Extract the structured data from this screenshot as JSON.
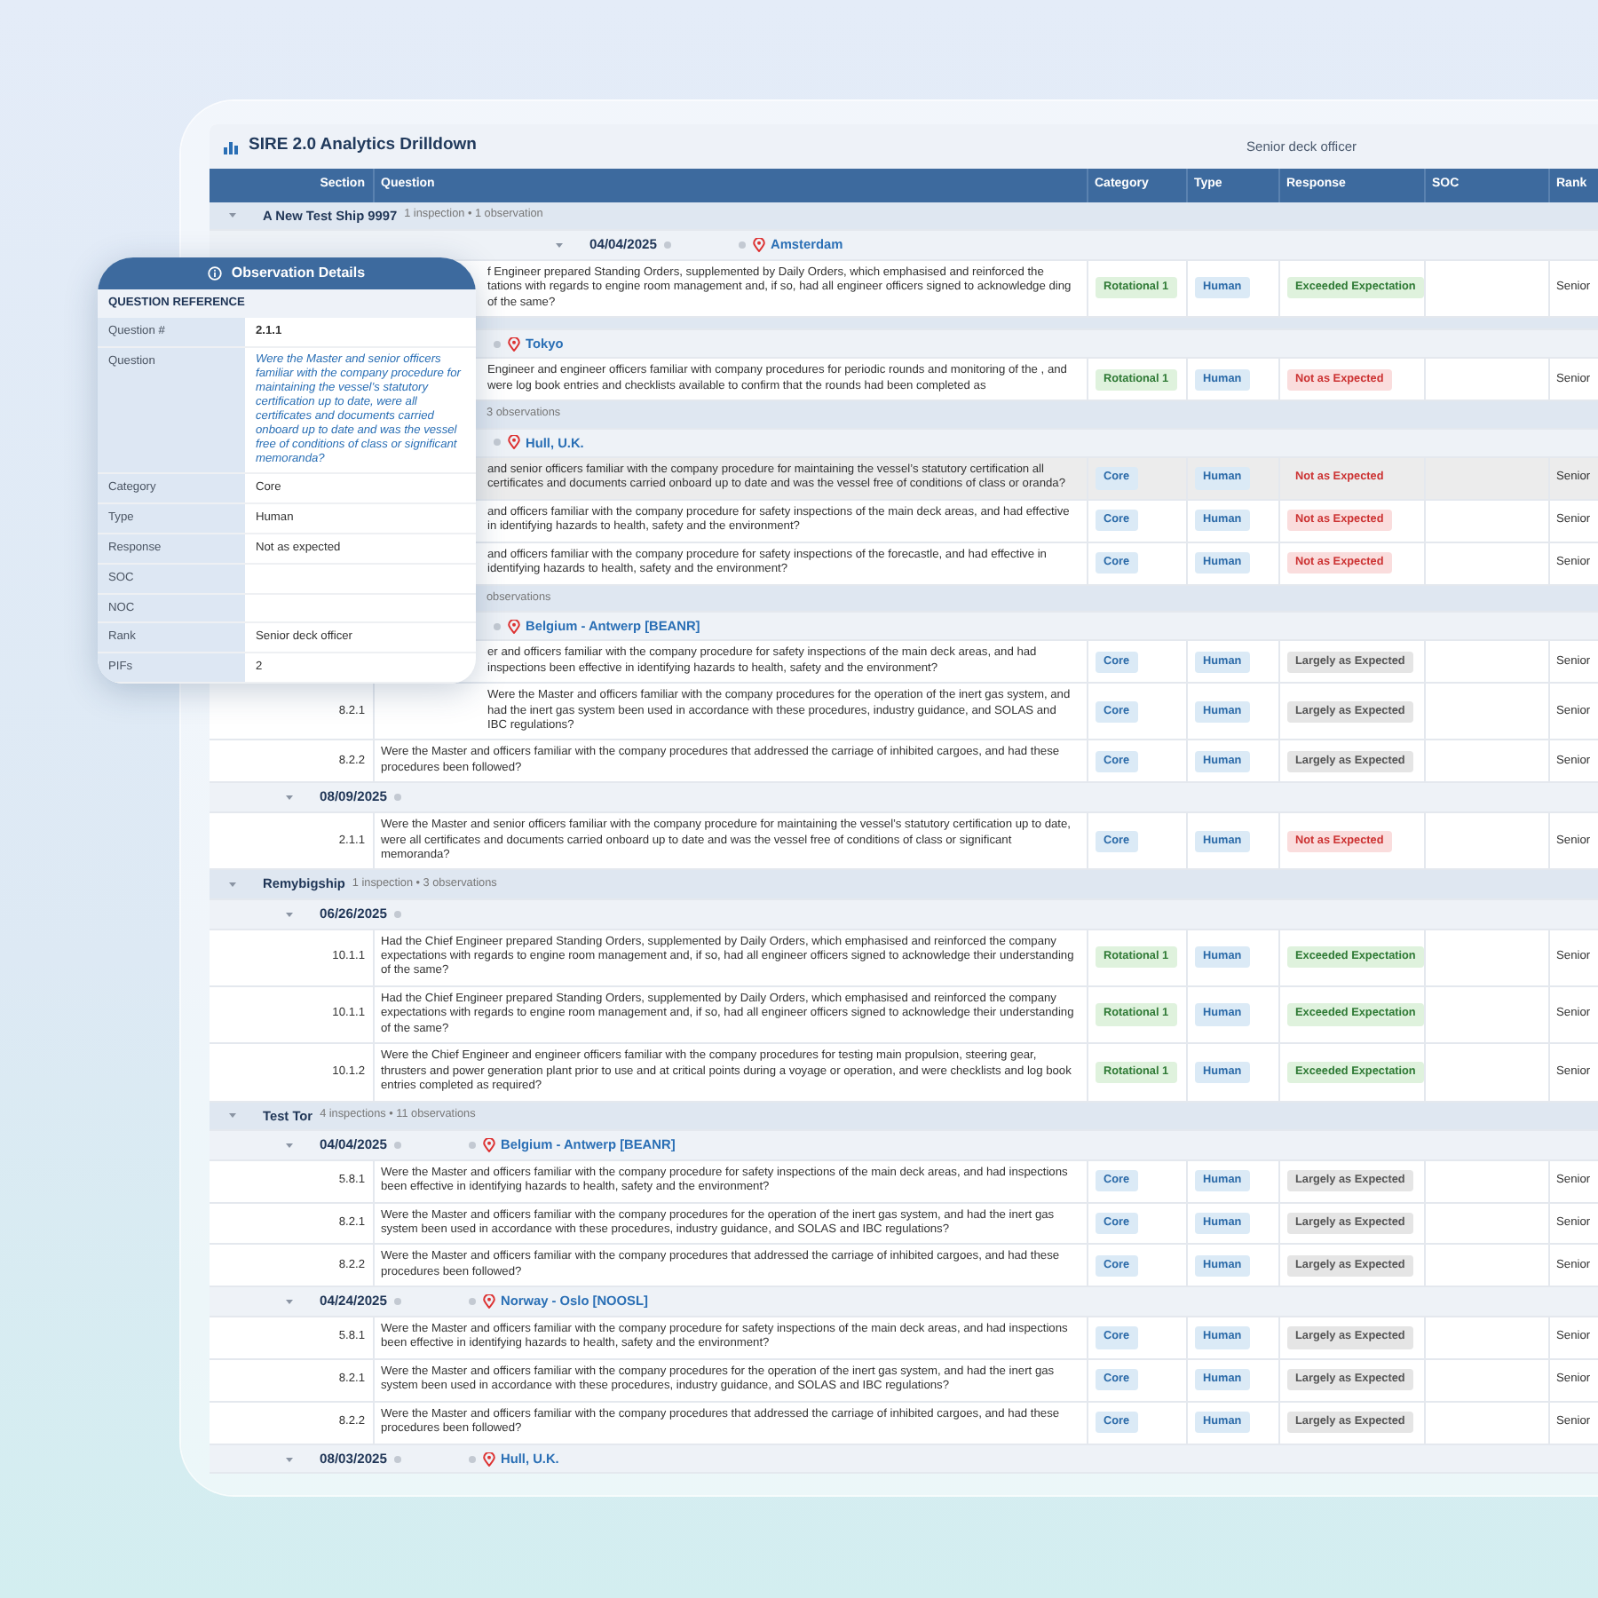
{
  "window": {
    "title": "SIRE 2.0 Analytics Drilldown",
    "filter": "Senior deck officer"
  },
  "table": {
    "columns": [
      "Section",
      "Question",
      "Category",
      "Type",
      "Response",
      "SOC",
      "Rank"
    ],
    "groups": [
      {
        "name": "A New Test Ship 9997",
        "summary": "1 inspection • 1 observation",
        "expanded": true,
        "inspections": [
          {
            "date": "04/04/2025",
            "location": "Amsterdam",
            "expanded": true,
            "rows": [
              {
                "question": "f Engineer prepared Standing Orders, supplemented by Daily Orders, which emphasised and reinforced the tations with regards to engine room management and, if so, had all engineer officers signed to acknowledge ding of the same?",
                "category": {
                  "text": "Rotational 1",
                  "kind": "rotational"
                },
                "type": "Human",
                "response": {
                  "text": "Exceeded Expectation",
                  "kind": "exceeded"
                },
                "rank": "Senior",
                "selected": false
              }
            ]
          }
        ]
      },
      {
        "inspections": [
          {
            "location": "Tokyo",
            "rows": [
              {
                "question": "Engineer and engineer officers familiar with company procedures for periodic rounds and monitoring of the , and were log book entries and checklists available to confirm that the rounds had been completed as",
                "category": {
                  "text": "Rotational 1",
                  "kind": "rotational"
                },
                "type": "Human",
                "response": {
                  "text": "Not as Expected",
                  "kind": "not"
                },
                "rank": "Senior",
                "selected": false
              }
            ]
          }
        ]
      },
      {
        "summary": "3 observations",
        "inspections": [
          {
            "location": "Hull, U.K.",
            "rows": [
              {
                "question": "and senior officers familiar with the company procedure for maintaining the vessel’s statutory certification all certificates and documents carried onboard up to date and was the vessel free of conditions of class or oranda?",
                "category": {
                  "text": "Core",
                  "kind": "core"
                },
                "type": "Human",
                "response": {
                  "text": "Not as Expected",
                  "kind": "not"
                },
                "rank": "Senior",
                "selected": true
              },
              {
                "question": "and officers familiar with the company procedure for safety inspections of the main deck areas, and had effective in identifying hazards to health, safety and the environment?",
                "category": {
                  "text": "Core",
                  "kind": "core"
                },
                "type": "Human",
                "response": {
                  "text": "Not as Expected",
                  "kind": "not"
                },
                "rank": "Senior",
                "selected": false
              },
              {
                "question": "and officers familiar with the company procedure for safety inspections of the forecastle, and had effective in identifying hazards to health, safety and the environment?",
                "category": {
                  "text": "Core",
                  "kind": "core"
                },
                "type": "Human",
                "response": {
                  "text": "Not as Expected",
                  "kind": "not"
                },
                "rank": "Senior",
                "selected": false
              }
            ]
          }
        ]
      },
      {
        "summary": "observations",
        "inspections": [
          {
            "location": "Belgium - Antwerp [BEANR]",
            "rows": [
              {
                "question": "er and officers familiar with the company procedure for safety inspections of the main deck areas, and had inspections been effective in identifying hazards to health, safety and the environment?",
                "category": {
                  "text": "Core",
                  "kind": "core"
                },
                "type": "Human",
                "response": {
                  "text": "Largely as Expected",
                  "kind": "largely"
                },
                "rank": "Senior",
                "selected": false
              },
              {
                "section": "8.2.1",
                "question": "Were the Master and officers familiar with the company procedures for the operation of the inert gas system, and had the inert gas system been used in accordance with these procedures, industry guidance, and SOLAS and IBC regulations?",
                "category": {
                  "text": "Core",
                  "kind": "core"
                },
                "type": "Human",
                "response": {
                  "text": "Largely as Expected",
                  "kind": "largely"
                },
                "rank": "Senior",
                "selected": false
              },
              {
                "section": "8.2.2",
                "question": "Were the Master and officers familiar with the company procedures that addressed the carriage of inhibited cargoes, and had these procedures been followed?",
                "category": {
                  "text": "Core",
                  "kind": "core"
                },
                "type": "Human",
                "response": {
                  "text": "Largely as Expected",
                  "kind": "largely"
                },
                "rank": "Senior",
                "selected": false
              }
            ]
          },
          {
            "date": "08/09/2025",
            "expanded": true,
            "rows": [
              {
                "section": "2.1.1",
                "question": "Were the Master and senior officers familiar with the company procedure for maintaining the vessel’s statutory certification up to date, were all certificates and documents carried onboard up to date and was the vessel free of conditions of class or significant memoranda?",
                "category": {
                  "text": "Core",
                  "kind": "core"
                },
                "type": "Human",
                "response": {
                  "text": "Not as Expected",
                  "kind": "not"
                },
                "rank": "Senior",
                "selected": false
              }
            ]
          }
        ]
      },
      {
        "name": "Remybigship",
        "summary": "1 inspection • 3 observations",
        "expanded": true,
        "inspections": [
          {
            "date": "06/26/2025",
            "expanded": true,
            "rows": [
              {
                "section": "10.1.1",
                "question": "Had the Chief Engineer prepared Standing Orders, supplemented by Daily Orders, which emphasised and reinforced the company expectations with regards to engine room management and, if so, had all engineer officers signed to acknowledge their understanding of the same?",
                "category": {
                  "text": "Rotational 1",
                  "kind": "rotational"
                },
                "type": "Human",
                "response": {
                  "text": "Exceeded Expectation",
                  "kind": "exceeded"
                },
                "rank": "Senior",
                "selected": false
              },
              {
                "section": "10.1.1",
                "question": "Had the Chief Engineer prepared Standing Orders, supplemented by Daily Orders, which emphasised and reinforced the company expectations with regards to engine room management and, if so, had all engineer officers signed to acknowledge their understanding of the same?",
                "category": {
                  "text": "Rotational 1",
                  "kind": "rotational"
                },
                "type": "Human",
                "response": {
                  "text": "Exceeded Expectation",
                  "kind": "exceeded"
                },
                "rank": "Senior",
                "selected": false
              },
              {
                "section": "10.1.2",
                "question": "Were the Chief Engineer and engineer officers familiar with the company procedures for testing main propulsion, steering gear, thrusters and power generation plant prior to use and at critical points during a voyage or operation, and were checklists and log book entries completed as required?",
                "category": {
                  "text": "Rotational 1",
                  "kind": "rotational"
                },
                "type": "Human",
                "response": {
                  "text": "Exceeded Expectation",
                  "kind": "exceeded"
                },
                "rank": "Senior",
                "selected": false
              }
            ]
          }
        ]
      },
      {
        "name": "Test Tor",
        "summary": "4 inspections • 11 observations",
        "expanded": true,
        "inspections": [
          {
            "date": "04/04/2025",
            "location": "Belgium - Antwerp [BEANR]",
            "expanded": true,
            "rows": [
              {
                "section": "5.8.1",
                "question": "Were the Master and officers familiar with the company procedure for safety inspections of the main deck areas, and had inspections been effective in identifying hazards to health, safety and the environment?",
                "category": {
                  "text": "Core",
                  "kind": "core"
                },
                "type": "Human",
                "response": {
                  "text": "Largely as Expected",
                  "kind": "largely"
                },
                "rank": "Senior",
                "selected": false
              },
              {
                "section": "8.2.1",
                "question": "Were the Master and officers familiar with the company procedures for the operation of the inert gas system, and had the inert gas system been used in accordance with these procedures, industry guidance, and SOLAS and IBC regulations?",
                "category": {
                  "text": "Core",
                  "kind": "core"
                },
                "type": "Human",
                "response": {
                  "text": "Largely as Expected",
                  "kind": "largely"
                },
                "rank": "Senior",
                "selected": false
              },
              {
                "section": "8.2.2",
                "question": "Were the Master and officers familiar with the company procedures that addressed the carriage of inhibited cargoes, and had these procedures been followed?",
                "category": {
                  "text": "Core",
                  "kind": "core"
                },
                "type": "Human",
                "response": {
                  "text": "Largely as Expected",
                  "kind": "largely"
                },
                "rank": "Senior",
                "selected": false
              }
            ]
          },
          {
            "date": "04/24/2025",
            "location": "Norway - Oslo [NOOSL]",
            "expanded": true,
            "rows": [
              {
                "section": "5.8.1",
                "question": "Were the Master and officers familiar with the company procedure for safety inspections of the main deck areas, and had inspections been effective in identifying hazards to health, safety and the environment?",
                "category": {
                  "text": "Core",
                  "kind": "core"
                },
                "type": "Human",
                "response": {
                  "text": "Largely as Expected",
                  "kind": "largely"
                },
                "rank": "Senior",
                "selected": false
              },
              {
                "section": "8.2.1",
                "question": "Were the Master and officers familiar with the company procedures for the operation of the inert gas system, and had the inert gas system been used in accordance with these procedures, industry guidance, and SOLAS and IBC regulations?",
                "category": {
                  "text": "Core",
                  "kind": "core"
                },
                "type": "Human",
                "response": {
                  "text": "Largely as Expected",
                  "kind": "largely"
                },
                "rank": "Senior",
                "selected": false
              },
              {
                "section": "8.2.2",
                "question": "Were the Master and officers familiar with the company procedures that addressed the carriage of inhibited cargoes, and had these procedures been followed?",
                "category": {
                  "text": "Core",
                  "kind": "core"
                },
                "type": "Human",
                "response": {
                  "text": "Largely as Expected",
                  "kind": "largely"
                },
                "rank": "Senior",
                "selected": false
              }
            ]
          },
          {
            "date": "08/03/2025",
            "location": "Hull, U.K.",
            "expanded": true
          }
        ]
      }
    ]
  },
  "details": {
    "title": "Observation Details",
    "section": "QUESTION REFERENCE",
    "fields": [
      {
        "label": "Question #",
        "value": "2.1.1",
        "kind": "code"
      },
      {
        "label": "Question",
        "value": "Were the Master and senior officers familiar with the company procedure for maintaining the vessel’s statutory certification up to date, were all certificates and documents carried onboard up to date and was the vessel free of conditions of class or significant memoranda?",
        "kind": "question"
      },
      {
        "label": "Category",
        "value": "Core",
        "kind": "text"
      },
      {
        "label": "Type",
        "value": "Human",
        "kind": "text"
      },
      {
        "label": "Response",
        "value": "Not as expected",
        "kind": "text"
      },
      {
        "label": "SOC",
        "kind": "text"
      },
      {
        "label": "NOC",
        "kind": "text"
      },
      {
        "label": "Rank",
        "value": "Senior deck officer",
        "kind": "text"
      },
      {
        "label": "PIFs",
        "value": "2",
        "kind": "text"
      }
    ]
  }
}
